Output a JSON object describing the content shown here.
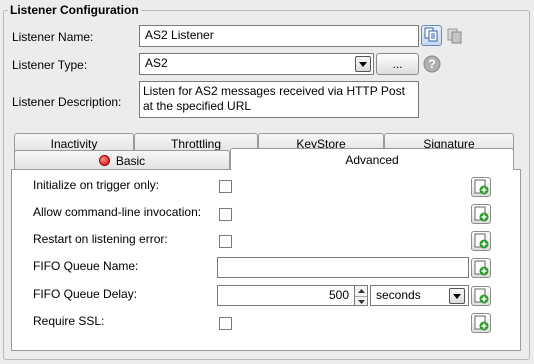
{
  "group": {
    "title": "Listener Configuration"
  },
  "listener": {
    "name_label": "Listener Name:",
    "name_value": "AS2 Listener",
    "type_label": "Listener Type:",
    "type_value": "AS2",
    "browse_label": "...",
    "desc_label": "Listener Description:",
    "desc_line1": "Listen for AS2 messages received via HTTP Post",
    "desc_line2": "at the specified URL"
  },
  "tabs": {
    "row1": [
      "Inactivity",
      "Throttling",
      "KeyStore",
      "Signature"
    ],
    "row2": [
      "Basic",
      "Advanced"
    ],
    "active": "Advanced"
  },
  "advanced": {
    "init_label": "Initialize on trigger only:",
    "cmdline_label": "Allow command-line invocation:",
    "restart_label": "Restart on listening error:",
    "fifo_name_label": "FIFO Queue Name:",
    "fifo_name_value": "",
    "fifo_delay_label": "FIFO Queue Delay:",
    "fifo_delay_value": "500",
    "fifo_delay_unit": "seconds",
    "ssl_label": "Require SSL:"
  },
  "icons": {
    "copy": "copy-icon",
    "paste": "paste-icon",
    "help": "help-icon",
    "add": "add-variable-icon",
    "error": "error-indicator-icon"
  }
}
